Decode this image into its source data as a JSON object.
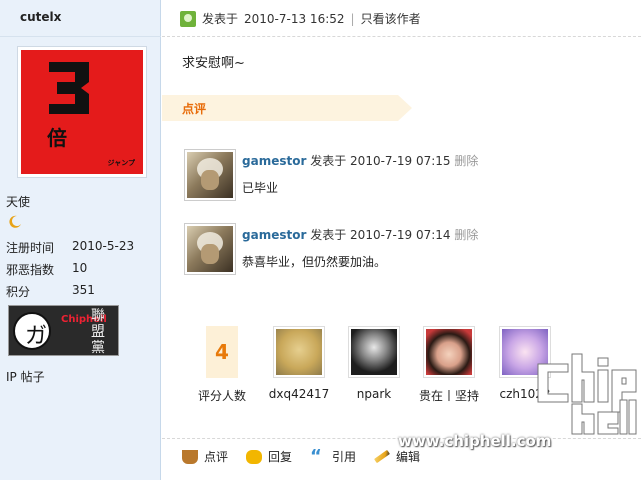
{
  "user": {
    "username": "cutelx",
    "rank": "天使",
    "stats": [
      {
        "label": "注册时间",
        "value": "2010-5-23"
      },
      {
        "label": "邪恶指数",
        "value": "10"
      },
      {
        "label": "积分",
        "value": "351"
      }
    ],
    "ip_label": "IP 帖子",
    "badge_brand": "Chiphell",
    "badge_chars": "聯盟黨"
  },
  "post": {
    "posted_label": "发表于",
    "posted_time": "2010-7-13 16:52",
    "separator": "|",
    "author_only": "只看该作者",
    "content": "求安慰啊~"
  },
  "comment_section": {
    "title": "点评"
  },
  "comments": [
    {
      "user": "gamestor",
      "posted_label": "发表于",
      "time": "2010-7-19 07:15",
      "delete": "删除",
      "text": "已毕业"
    },
    {
      "user": "gamestor",
      "posted_label": "发表于",
      "time": "2010-7-19 07:14",
      "delete": "删除",
      "text": "恭喜毕业，但仍然要加油。"
    }
  ],
  "ratings": {
    "count": "4",
    "count_label": "评分人数",
    "raters": [
      "dxq42417",
      "npark",
      "贵在丨坚持",
      "czh1023"
    ]
  },
  "actions": {
    "comment": "点评",
    "reply": "回复",
    "quote": "引用",
    "edit": "编辑"
  },
  "watermark": {
    "site": "www.chiphell.com",
    "logo_text": "chip hell"
  },
  "colors": {
    "sidebar_bg": "#e9f1fa",
    "accent_orange": "#e86c0a",
    "user_link": "#2a6a9a"
  }
}
